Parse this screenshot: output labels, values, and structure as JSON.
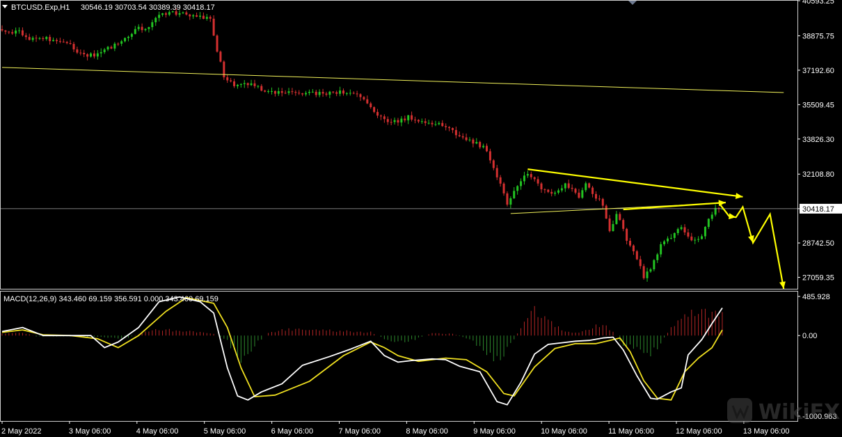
{
  "header": {
    "symbol_label": "BTCUSD.Exp,H1",
    "ohlc_label": "30546.19 30703.54 30389.39 30418.17"
  },
  "indicator": {
    "label": "MACD(12,26,9) 343.460 69.159 356.591 0.000 343.460 69.159"
  },
  "watermark": {
    "text": "WikiFX"
  },
  "colors": {
    "background": "#000000",
    "bull": "#22c322",
    "bear": "#d43030",
    "trendline": "#f2f25a",
    "annotation": "#ffff00",
    "macd_line": "#ffffff",
    "signal_line": "#f0e020",
    "hist_positive": "#b52626",
    "hist_negative": "#2e8b2e",
    "bid_line": "#a8a8a8"
  },
  "chart_data": [
    {
      "type": "candlestick",
      "y_ticks": [
        "40593.25",
        "38875.75",
        "37192.60",
        "35509.45",
        "33826.30",
        "32108.80",
        "30418.17",
        "28742.50",
        "27059.35"
      ],
      "ylim": [
        26500,
        40593.25
      ],
      "current_price": "30418.17",
      "x_ticks": [
        "2 May 2022",
        "3 May 06:00",
        "4 May 06:00",
        "5 May 06:00",
        "6 May 06:00",
        "7 May 06:00",
        "8 May 06:00",
        "9 May 06:00",
        "10 May 06:00",
        "11 May 06:00",
        "12 May 06:00",
        "13 May 06:00"
      ],
      "path": [
        [
          0,
          39200
        ],
        [
          3,
          39100
        ],
        [
          6,
          39050
        ],
        [
          9,
          38700
        ],
        [
          12,
          38750
        ],
        [
          16,
          38700
        ],
        [
          20,
          38600
        ],
        [
          24,
          38000
        ],
        [
          28,
          37900
        ],
        [
          32,
          38250
        ],
        [
          36,
          38600
        ],
        [
          40,
          39200
        ],
        [
          44,
          39300
        ],
        [
          47,
          39850
        ],
        [
          50,
          40050
        ],
        [
          53,
          39950
        ],
        [
          56,
          39900
        ],
        [
          59,
          39800
        ],
        [
          62,
          39750
        ],
        [
          64,
          38200
        ],
        [
          66,
          36900
        ],
        [
          69,
          36500
        ],
        [
          74,
          36450
        ],
        [
          80,
          36100
        ],
        [
          90,
          36050
        ],
        [
          100,
          36100
        ],
        [
          106,
          35900
        ],
        [
          110,
          35100
        ],
        [
          115,
          34600
        ],
        [
          120,
          34900
        ],
        [
          125,
          34600
        ],
        [
          130,
          34500
        ],
        [
          135,
          34000
        ],
        [
          140,
          33600
        ],
        [
          143,
          33300
        ],
        [
          146,
          32000
        ],
        [
          148,
          31200
        ],
        [
          149,
          30600
        ],
        [
          152,
          31500
        ],
        [
          155,
          32200
        ],
        [
          159,
          31400
        ],
        [
          162,
          31100
        ],
        [
          166,
          31600
        ],
        [
          170,
          31000
        ],
        [
          172,
          31700
        ],
        [
          174,
          31200
        ],
        [
          177,
          30600
        ],
        [
          179,
          29300
        ],
        [
          181,
          30200
        ],
        [
          184,
          28900
        ],
        [
          186,
          28300
        ],
        [
          188,
          27600
        ],
        [
          189,
          27100
        ],
        [
          191,
          27500
        ],
        [
          194,
          28600
        ],
        [
          197,
          29000
        ],
        [
          200,
          29500
        ],
        [
          203,
          28800
        ],
        [
          206,
          29100
        ],
        [
          208,
          29900
        ],
        [
          210,
          30500
        ],
        [
          211,
          30418
        ]
      ],
      "trendlines": [
        {
          "from": [
            0,
            37330
          ],
          "to": [
            229,
            36100
          ]
        },
        {
          "from": [
            149,
            30180
          ],
          "to": [
            212,
            30700
          ]
        }
      ],
      "annotations": [
        {
          "type": "arrow",
          "from": [
            154,
            32350
          ],
          "to": [
            217,
            31000
          ]
        },
        {
          "type": "arrow",
          "from": [
            182,
            30380
          ],
          "to": [
            212,
            30720
          ]
        },
        {
          "type": "projection",
          "points": [
            [
              210,
              30700
            ],
            [
              213,
              30050
            ],
            [
              215,
              30000
            ],
            [
              217,
              30500
            ],
            [
              220,
              28750
            ],
            [
              225,
              30150
            ],
            [
              229,
              26500
            ]
          ]
        }
      ]
    },
    {
      "type": "macd",
      "params": "12,26,9",
      "zero_label": "0.00",
      "y_ticks": [
        "485.928",
        "0.00",
        "-1000.963"
      ],
      "ylim": [
        -1000.963,
        485.928
      ],
      "macd": [
        [
          0,
          50
        ],
        [
          6,
          100
        ],
        [
          12,
          0
        ],
        [
          20,
          0
        ],
        [
          26,
          0
        ],
        [
          30,
          -150
        ],
        [
          34,
          -80
        ],
        [
          40,
          100
        ],
        [
          46,
          420
        ],
        [
          52,
          480
        ],
        [
          58,
          420
        ],
        [
          62,
          280
        ],
        [
          66,
          -400
        ],
        [
          69,
          -750
        ],
        [
          72,
          -800
        ],
        [
          76,
          -700
        ],
        [
          82,
          -600
        ],
        [
          88,
          -370
        ],
        [
          96,
          -260
        ],
        [
          102,
          -170
        ],
        [
          108,
          -70
        ],
        [
          112,
          -250
        ],
        [
          116,
          -330
        ],
        [
          120,
          -310
        ],
        [
          126,
          -290
        ],
        [
          130,
          -300
        ],
        [
          134,
          -380
        ],
        [
          140,
          -450
        ],
        [
          145,
          -820
        ],
        [
          148,
          -860
        ],
        [
          152,
          -580
        ],
        [
          156,
          -230
        ],
        [
          160,
          -110
        ],
        [
          164,
          -90
        ],
        [
          168,
          -70
        ],
        [
          172,
          -60
        ],
        [
          176,
          -30
        ],
        [
          179,
          -20
        ],
        [
          182,
          -180
        ],
        [
          186,
          -500
        ],
        [
          190,
          -780
        ],
        [
          192,
          -790
        ],
        [
          196,
          -700
        ],
        [
          199,
          -650
        ],
        [
          201,
          -240
        ],
        [
          205,
          -50
        ],
        [
          208,
          150
        ],
        [
          211,
          343
        ]
      ],
      "signal": [
        [
          0,
          40
        ],
        [
          6,
          70
        ],
        [
          12,
          10
        ],
        [
          20,
          0
        ],
        [
          28,
          -40
        ],
        [
          34,
          -150
        ],
        [
          40,
          0
        ],
        [
          48,
          300
        ],
        [
          54,
          470
        ],
        [
          62,
          400
        ],
        [
          66,
          100
        ],
        [
          70,
          -400
        ],
        [
          74,
          -760
        ],
        [
          80,
          -740
        ],
        [
          90,
          -570
        ],
        [
          100,
          -250
        ],
        [
          108,
          -80
        ],
        [
          112,
          -150
        ],
        [
          116,
          -250
        ],
        [
          122,
          -320
        ],
        [
          130,
          -280
        ],
        [
          136,
          -300
        ],
        [
          142,
          -450
        ],
        [
          147,
          -720
        ],
        [
          150,
          -750
        ],
        [
          156,
          -390
        ],
        [
          162,
          -160
        ],
        [
          168,
          -100
        ],
        [
          174,
          -100
        ],
        [
          178,
          -60
        ],
        [
          181,
          -30
        ],
        [
          184,
          -200
        ],
        [
          188,
          -560
        ],
        [
          192,
          -780
        ],
        [
          196,
          -800
        ],
        [
          200,
          -450
        ],
        [
          204,
          -280
        ],
        [
          208,
          -150
        ],
        [
          211,
          69
        ]
      ],
      "histogram_profile": [
        [
          0,
          20
        ],
        [
          6,
          40
        ],
        [
          10,
          -10
        ],
        [
          20,
          -10
        ],
        [
          30,
          -20
        ],
        [
          36,
          -40
        ],
        [
          44,
          80
        ],
        [
          52,
          60
        ],
        [
          58,
          40
        ],
        [
          62,
          20
        ],
        [
          66,
          -60
        ],
        [
          68,
          -200
        ],
        [
          70,
          -300
        ],
        [
          74,
          -120
        ],
        [
          78,
          40
        ],
        [
          84,
          80
        ],
        [
          90,
          70
        ],
        [
          100,
          55
        ],
        [
          108,
          40
        ],
        [
          112,
          -40
        ],
        [
          116,
          -80
        ],
        [
          120,
          -60
        ],
        [
          126,
          30
        ],
        [
          132,
          20
        ],
        [
          138,
          -60
        ],
        [
          142,
          -230
        ],
        [
          145,
          -290
        ],
        [
          148,
          -180
        ],
        [
          152,
          100
        ],
        [
          156,
          310
        ],
        [
          160,
          200
        ],
        [
          164,
          60
        ],
        [
          168,
          30
        ],
        [
          172,
          80
        ],
        [
          176,
          140
        ],
        [
          179,
          60
        ],
        [
          182,
          -120
        ],
        [
          186,
          -160
        ],
        [
          190,
          -210
        ],
        [
          192,
          -150
        ],
        [
          196,
          90
        ],
        [
          200,
          280
        ],
        [
          204,
          330
        ],
        [
          208,
          260
        ],
        [
          211,
          280
        ]
      ]
    }
  ]
}
